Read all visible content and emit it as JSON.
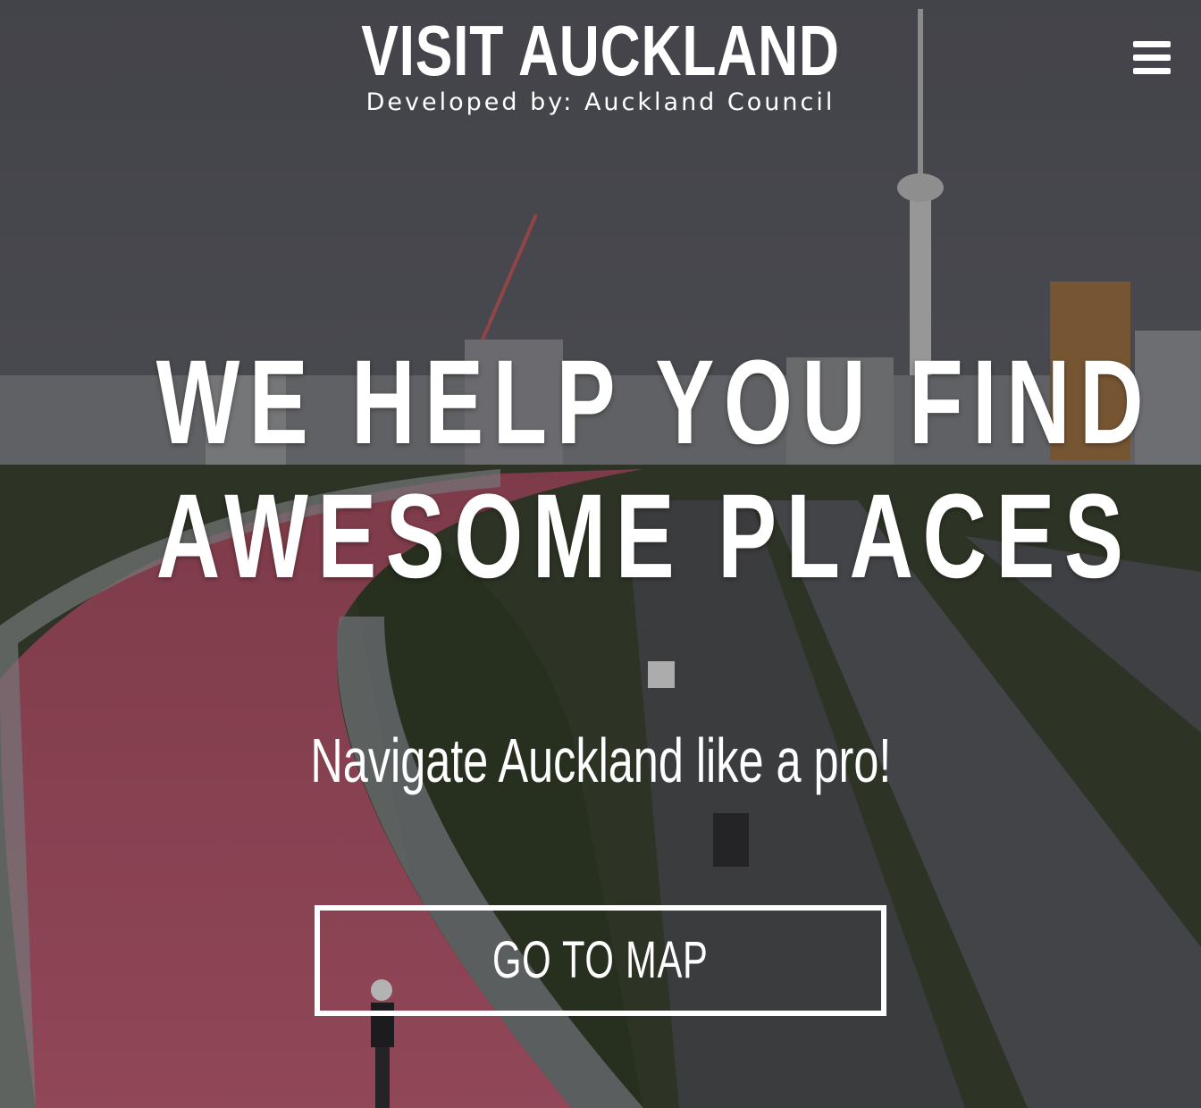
{
  "header": {
    "title": "VISIT AUCKLAND",
    "subtitle": "Developed by: Auckland Council",
    "menu_icon": "hamburger-menu-icon"
  },
  "hero": {
    "headline_line1": "WE HELP YOU FIND",
    "headline_line2": "AWESOME PLACES",
    "tagline": "Navigate Auckland like a pro!",
    "cta_label": "GO TO MAP"
  },
  "colors": {
    "text": "#ffffff",
    "sky": "#5d5f66",
    "path": "#b14a5e",
    "greenery": "#3e4a2c"
  }
}
